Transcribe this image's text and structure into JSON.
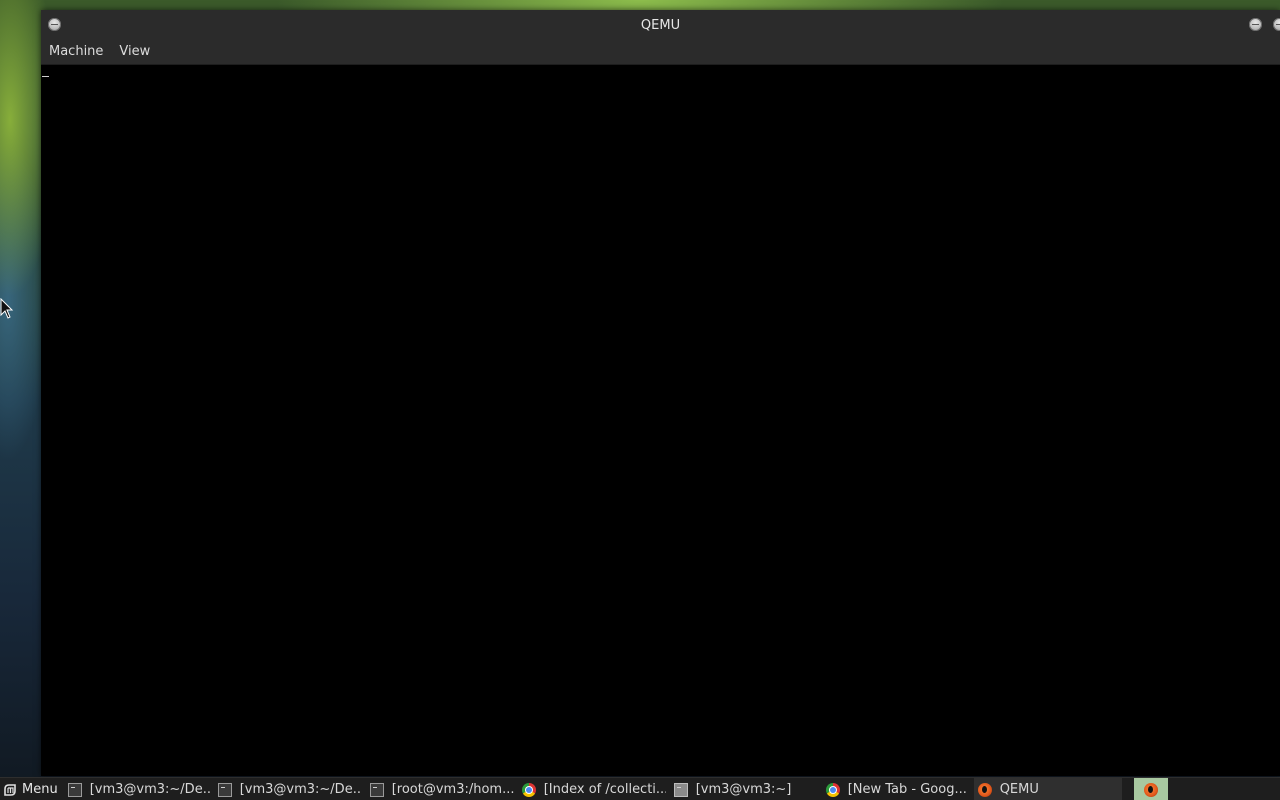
{
  "window": {
    "title": "QEMU",
    "menu": [
      {
        "label": "Machine"
      },
      {
        "label": "View"
      }
    ]
  },
  "taskbar": {
    "menu_label": "Menu",
    "tasks": [
      {
        "label": "[vm3@vm3:~/De...",
        "icon": "terminal-icon"
      },
      {
        "label": "[vm3@vm3:~/De...",
        "icon": "terminal-icon"
      },
      {
        "label": "[root@vm3:/hom...",
        "icon": "terminal-icon"
      },
      {
        "label": "[Index of /collecti...",
        "icon": "chrome-icon"
      },
      {
        "label": "[vm3@vm3:~]",
        "icon": "terminal-icon"
      },
      {
        "label": "[New Tab - Goog...",
        "icon": "chrome-icon"
      },
      {
        "label": "QEMU",
        "icon": "qemu-icon"
      }
    ]
  }
}
